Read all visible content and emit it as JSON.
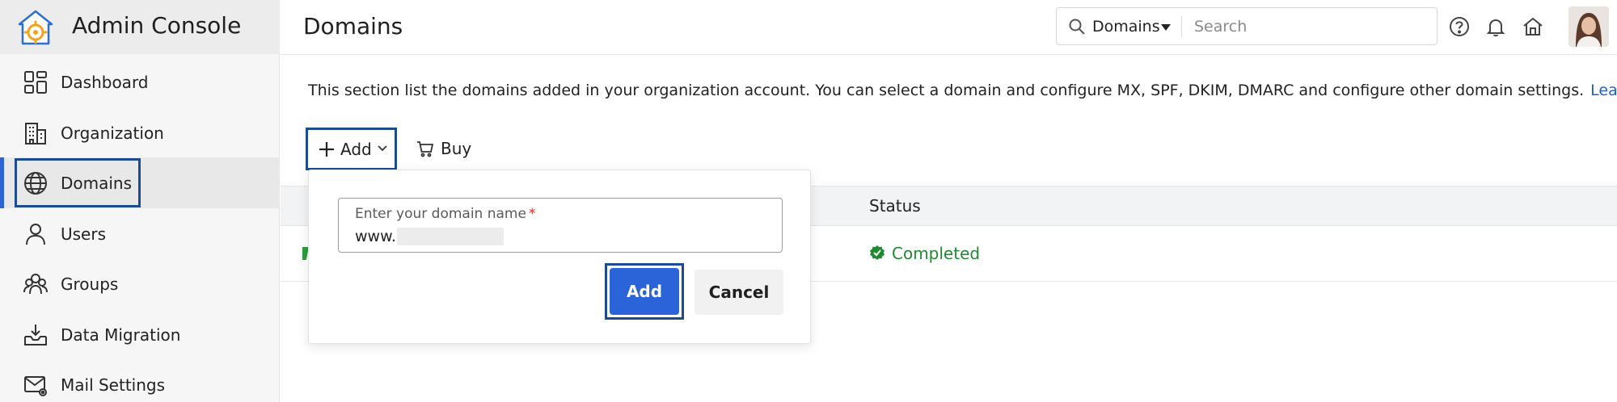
{
  "app": {
    "title": "Admin Console"
  },
  "sidebar": {
    "items": [
      {
        "label": "Dashboard",
        "icon": "dashboard-icon"
      },
      {
        "label": "Organization",
        "icon": "building-icon"
      },
      {
        "label": "Domains",
        "icon": "globe-icon",
        "active": true
      },
      {
        "label": "Users",
        "icon": "user-icon"
      },
      {
        "label": "Groups",
        "icon": "group-icon"
      },
      {
        "label": "Data Migration",
        "icon": "inbox-download-icon"
      },
      {
        "label": "Mail Settings",
        "icon": "mail-settings-icon"
      }
    ]
  },
  "header": {
    "page_title": "Domains",
    "search": {
      "scope": "Domains",
      "placeholder": "Search"
    },
    "icons": [
      "help-icon",
      "bell-icon",
      "home-icon"
    ]
  },
  "content": {
    "description": "This section list the domains added in your organization account. You can select a domain and configure MX, SPF, DKIM, DMARC and configure other domain settings.",
    "learn_more": "Learn more",
    "toolbar": {
      "add_label": "Add",
      "buy_label": "Buy"
    },
    "table": {
      "columns": [
        "Status"
      ],
      "rows": [
        {
          "status": "Completed"
        }
      ]
    }
  },
  "popover": {
    "field_label": "Enter your domain name",
    "required_mark": "*",
    "prefix": "www.",
    "value": "",
    "add_button": "Add",
    "cancel_button": "Cancel"
  },
  "colors": {
    "accent": "#2b63d9",
    "highlight_border": "#1d4b8f",
    "success": "#1f8a32",
    "link": "#2160c4"
  }
}
